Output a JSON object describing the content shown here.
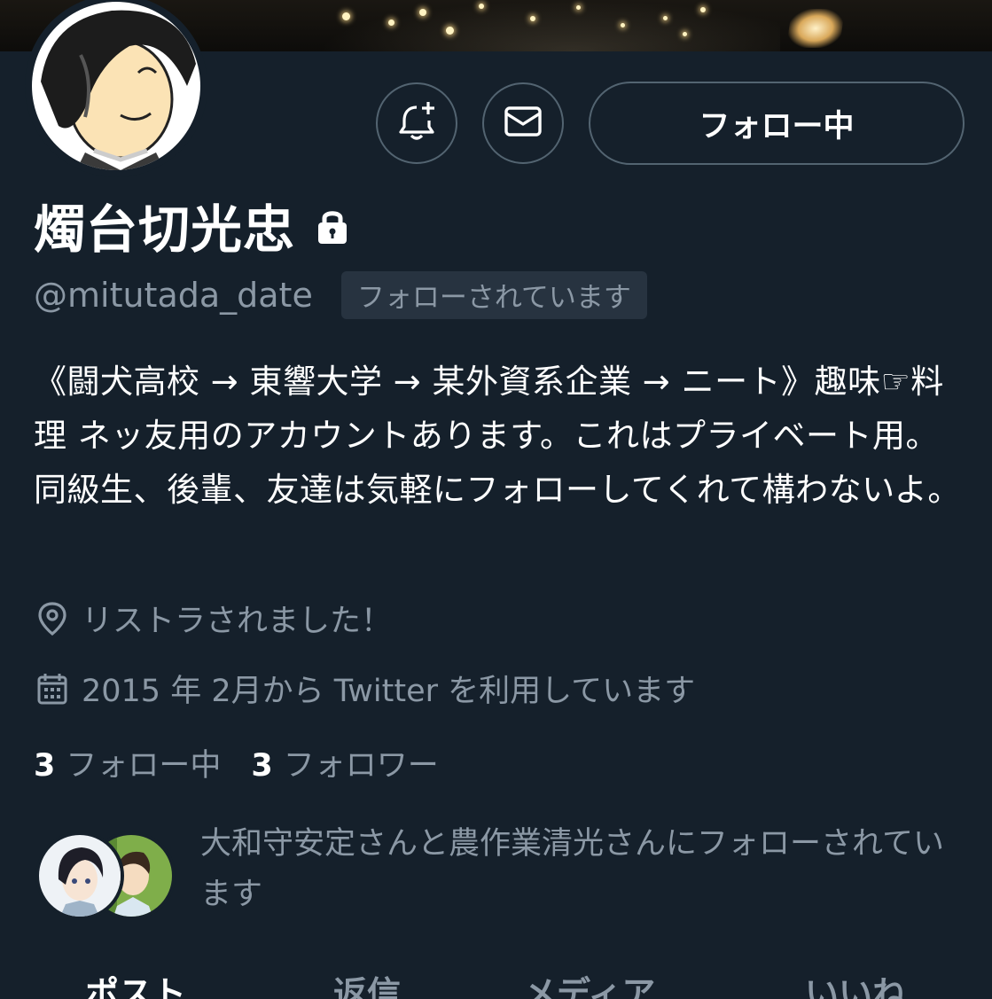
{
  "profile": {
    "display_name": "燭台切光忠",
    "handle": "@mitutada_date",
    "follows_you_badge": "フォローされています",
    "bio": "《闘犬高校 → 東響大学 → 某外資系企業 → ニート》趣味☞料理 ネッ友用のアカウントあります。これはプライベート用。同級生、後輩、友達は気軽にフォローしてくれて構わないよ。",
    "location": "リストラされました！",
    "joined": "2015 年 2月から Twitter を利用しています",
    "following_count": "3",
    "following_label": "フォロー中",
    "followers_count": "3",
    "followers_label": "フォロワー",
    "followed_by_text": "大和守安定さんと農作業清光さんにフォローされています"
  },
  "actions": {
    "follow_button_label": "フォロー中",
    "notify_icon": "bell-plus-icon",
    "message_icon": "mail-icon"
  },
  "tabs": [
    {
      "label": "ポスト",
      "active": true
    },
    {
      "label": "返信",
      "active": false
    },
    {
      "label": "メディア",
      "active": false
    },
    {
      "label": "いいね",
      "active": false
    }
  ],
  "colors": {
    "background": "#15202b",
    "secondary_text": "#8b98a5",
    "border": "#536471",
    "badge_bg": "#273340"
  }
}
